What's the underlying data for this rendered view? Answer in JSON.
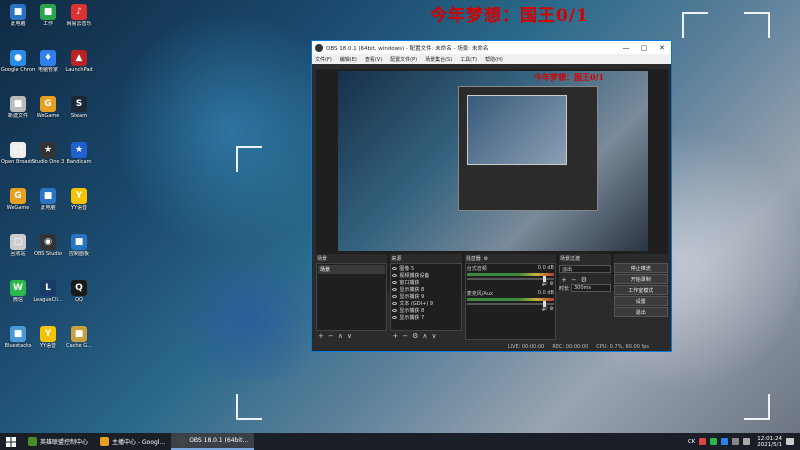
{
  "overlay_title": "今年梦想：国王0/1",
  "desktop_icons": [
    {
      "label": "此电脑",
      "color": "#2a74c4",
      "glyph": "■"
    },
    {
      "label": "工作",
      "color": "#2aa64a",
      "glyph": "■"
    },
    {
      "label": "网易云音乐",
      "color": "#d33",
      "glyph": "♪"
    },
    {
      "label": "Google Chrome",
      "color": "#2b8be8",
      "glyph": "●"
    },
    {
      "label": "电脑管家",
      "color": "#2f80ed",
      "glyph": "♦"
    },
    {
      "label": "LaunchPad",
      "color": "#b22",
      "glyph": "▲"
    },
    {
      "label": "新建文件",
      "color": "#bbb",
      "glyph": "■"
    },
    {
      "label": "WeGame",
      "color": "#e8a020",
      "glyph": "G"
    },
    {
      "label": "Steam",
      "color": "#1b2838",
      "glyph": "S"
    },
    {
      "label": "Open Broadcaster",
      "color": "#eee",
      "glyph": "□"
    },
    {
      "label": "Studio One 3",
      "color": "#333",
      "glyph": "★"
    },
    {
      "label": "Bandicam",
      "color": "#2060d0",
      "glyph": "★"
    },
    {
      "label": "WeGame",
      "color": "#e8a020",
      "glyph": "G"
    },
    {
      "label": "此电脑",
      "color": "#2a74c4",
      "glyph": "■"
    },
    {
      "label": "YY语音",
      "color": "#f5c400",
      "glyph": "Y"
    },
    {
      "label": "回收站",
      "color": "#ccc",
      "glyph": "▢"
    },
    {
      "label": "OBS Studio",
      "color": "#333",
      "glyph": "◉"
    },
    {
      "label": "控制面板",
      "color": "#2a74c4",
      "glyph": "■"
    },
    {
      "label": "微信",
      "color": "#2ab84a",
      "glyph": "W"
    },
    {
      "label": "LeagueCli...",
      "color": "#1a3a6a",
      "glyph": "L"
    },
    {
      "label": "QQ",
      "color": "#1a1a1a",
      "glyph": "Q"
    },
    {
      "label": "Bluestacks",
      "color": "#4a9ad8",
      "glyph": "■"
    },
    {
      "label": "YY语音",
      "color": "#f5c400",
      "glyph": "Y"
    },
    {
      "label": "Cache G...",
      "color": "#c8a040",
      "glyph": "■"
    }
  ],
  "obs": {
    "title": "OBS 18.0.1 (64bit, windows) - 配置文件: 未命名 - 场景: 未命名",
    "window_buttons": [
      "—",
      "□",
      "✕"
    ],
    "menu": [
      "文件(F)",
      "编辑(E)",
      "查看(V)",
      "配置文件(P)",
      "场景集合(S)",
      "工具(T)",
      "帮助(H)"
    ],
    "preview_overlay": "今年梦想：国王0/1",
    "docks": {
      "scenes": {
        "title": "场景",
        "items": [
          "场景"
        ]
      },
      "sources": {
        "title": "来源",
        "items": [
          "图像 5",
          "视频捕获设备",
          "窗口捕获",
          "显示捕获 8",
          "显示捕获 9",
          "文本 (GDI+) 9",
          "显示捕获 8",
          "显示捕获 7"
        ]
      },
      "mixer": {
        "title": "混音器",
        "rows": [
          {
            "name": "台式音频",
            "db": "0.0 dB",
            "level": 0.88
          },
          {
            "name": "麦克风/Aux",
            "db": "0.0 dB",
            "level": 0.88
          }
        ]
      },
      "transitions": {
        "title": "场景过渡",
        "type": "淡出",
        "duration_label": "时长",
        "duration": "300ms"
      },
      "controls": {
        "buttons": [
          "停止推流",
          "开始录制",
          "工作室模式",
          "设置",
          "退出"
        ]
      }
    },
    "status": {
      "live": "LIVE: 00:00:00",
      "rec": "REC: 00:00:00",
      "cpu": "CPU: 0.7%, 60.00 fps"
    }
  },
  "taskbar": {
    "items": [
      {
        "label": "英雄联盟控制中心",
        "color": "#4a8a2a",
        "active": false
      },
      {
        "label": "主播中心 - Googl...",
        "color": "#e8a020",
        "active": false
      },
      {
        "label": "OBS 18.0.1 (64bit...",
        "color": "#444",
        "active": true
      }
    ],
    "tray_text": "CK",
    "time": "12:01:24",
    "date": "2021/5/1"
  }
}
